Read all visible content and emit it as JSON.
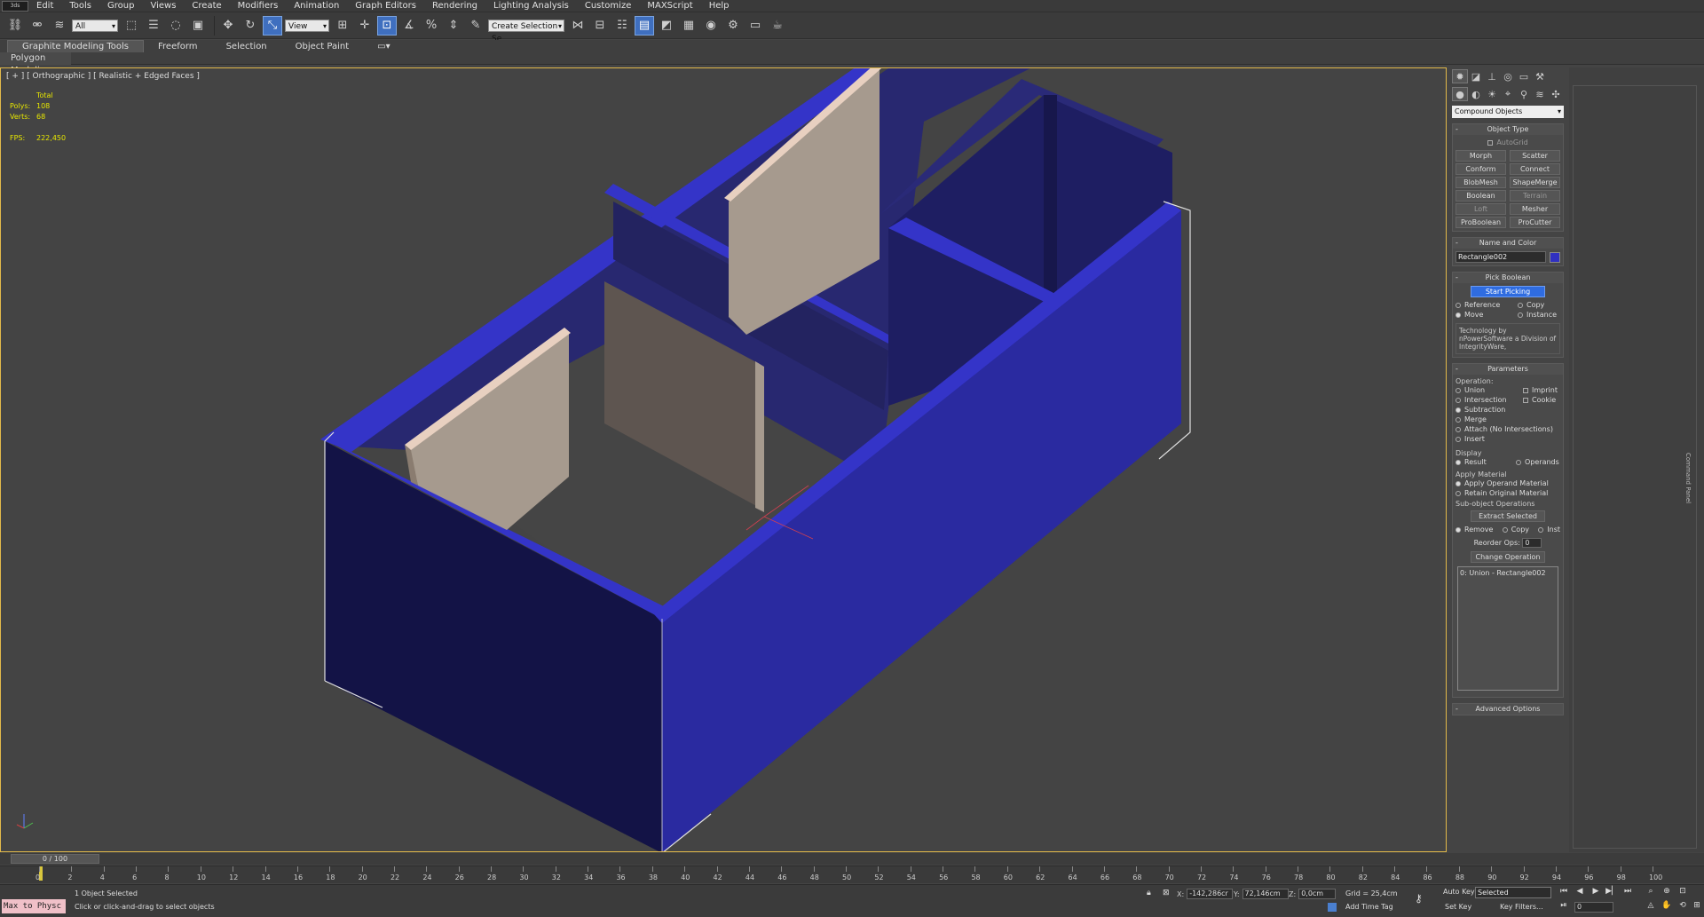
{
  "menubar": {
    "logo": "3ds",
    "items": [
      "Edit",
      "Tools",
      "Group",
      "Views",
      "Create",
      "Modifiers",
      "Animation",
      "Graph Editors",
      "Rendering",
      "Lighting Analysis",
      "Customize",
      "MAXScript",
      "Help"
    ]
  },
  "toolbar": {
    "selection_filter": "All",
    "reference_coord": "View",
    "named_selection": "Create Selection Se"
  },
  "ribbon": {
    "tabs": [
      "Graphite Modeling Tools",
      "Freeform",
      "Selection",
      "Object Paint"
    ],
    "sub_panel": "Polygon Modeling"
  },
  "viewport": {
    "label": "[ + ] [ Orthographic ] [ Realistic + Edged Faces ]",
    "stats": {
      "total_label": "Total",
      "polys_label": "Polys:",
      "polys_value": "108",
      "verts_label": "Verts:",
      "verts_value": "68",
      "fps_label": "FPS:",
      "fps_value": "222,450"
    }
  },
  "command_panel": {
    "category_dropdown": "Compound Objects",
    "object_type": {
      "title": "Object Type",
      "autogrid": "AutoGrid",
      "buttons": [
        "Morph",
        "Scatter",
        "Conform",
        "Connect",
        "BlobMesh",
        "ShapeMerge",
        "Boolean",
        "Terrain",
        "Loft",
        "Mesher",
        "ProBoolean",
        "ProCutter"
      ]
    },
    "name_and_color": {
      "title": "Name and Color",
      "name": "Rectangle002",
      "color": "#3030c0"
    },
    "pick_boolean": {
      "title": "Pick Boolean",
      "start_picking": "Start Picking",
      "reference": "Reference",
      "copy": "Copy",
      "move": "Move",
      "instance": "Instance",
      "note": "Technology by nPowerSoftware a Division of IntegrityWare,"
    },
    "parameters": {
      "title": "Parameters",
      "operations_label": "Operation:",
      "union": "Union",
      "intersection": "Intersection",
      "subtraction": "Subtraction",
      "merge": "Merge",
      "attach": "Attach (No Intersections)",
      "insert": "Insert",
      "imprint": "Imprint",
      "cookie": "Cookie",
      "display_label": "Display",
      "result": "Result",
      "operands": "Operands",
      "apply_material_label": "Apply Material",
      "apply_operand_material": "Apply Operand Material",
      "retain_original_material": "Retain Original Material",
      "subobject_ops_label": "Sub-object Operations",
      "extract_selected": "Extract Selected",
      "remove": "Remove",
      "copy": "Copy",
      "inst": "Inst",
      "reorder_ops": "Reorder Ops:",
      "reorder_value": "0",
      "change_operation": "Change Operation",
      "op_list_item": "0: Union - Rectangle002"
    },
    "advanced_options": "Advanced Options",
    "side_label": "Command Panel"
  },
  "timeline": {
    "slider_label": "0 / 100",
    "ticks": [
      "0",
      "2",
      "4",
      "6",
      "8",
      "10",
      "12",
      "14",
      "16",
      "18",
      "20",
      "22",
      "24",
      "26",
      "28",
      "30",
      "32",
      "34",
      "36",
      "38",
      "40",
      "42",
      "44",
      "46",
      "48",
      "50",
      "52",
      "54",
      "56",
      "58",
      "60",
      "62",
      "64",
      "66",
      "68",
      "70",
      "72",
      "74",
      "76",
      "78",
      "80",
      "82",
      "84",
      "86",
      "88",
      "90",
      "92",
      "94",
      "96",
      "98",
      "100"
    ]
  },
  "statusbar": {
    "maxscript": "Max to Physc",
    "selected_count": "1 Object Selected",
    "prompt": "Click or click-and-drag to select objects",
    "x_label": "X:",
    "x_value": "-142,286cr",
    "y_label": "Y:",
    "y_value": "72,146cm",
    "z_label": "Z:",
    "z_value": "0,0cm",
    "grid": "Grid = 25,4cm",
    "add_time_tag": "Add Time Tag",
    "auto_key": "Auto Key",
    "set_key": "Set Key",
    "key_mode": "Selected",
    "key_filters": "Key Filters...",
    "frame_value": "0"
  }
}
